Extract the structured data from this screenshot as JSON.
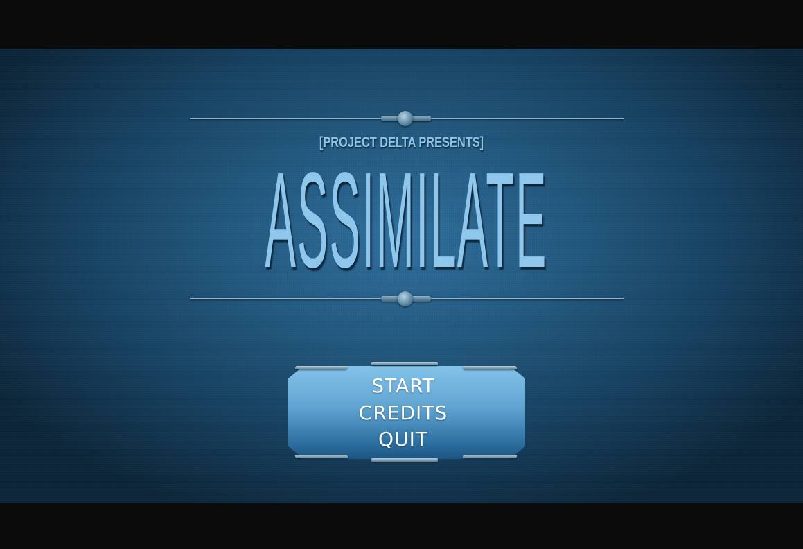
{
  "title_screen": {
    "presents": "[PROJECT DELTA PRESENTS]",
    "game_title": "ASSIMILATE"
  },
  "menu": {
    "items": [
      {
        "label": "START"
      },
      {
        "label": "CREDITS"
      },
      {
        "label": "QUIT"
      }
    ]
  },
  "colors": {
    "background": "#22597f",
    "title": "#8ec6ec",
    "menu_text": "#ffffff",
    "menu_plate": "#5fa4d0"
  }
}
